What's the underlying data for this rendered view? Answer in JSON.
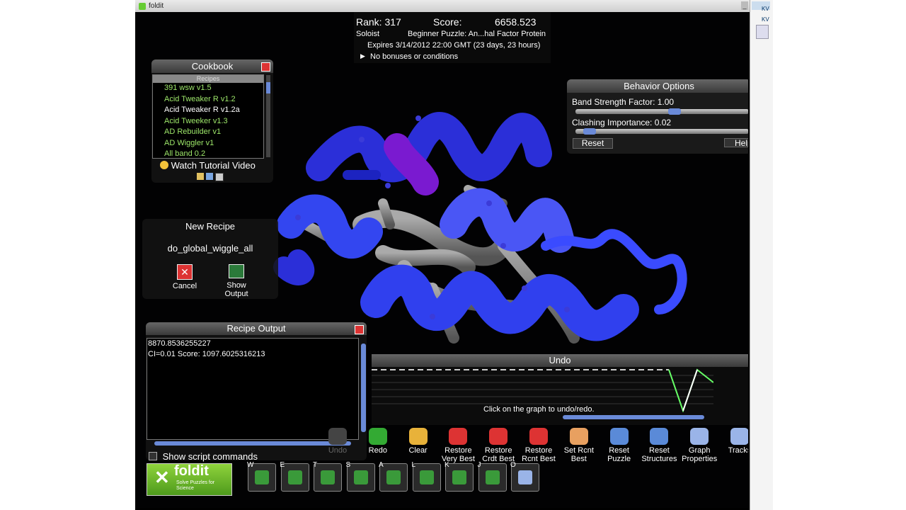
{
  "window": {
    "title": "foldit"
  },
  "status": {
    "rank_label": "Rank: 317",
    "score_label": "Score:",
    "score_value": "6658.523",
    "mode": "Soloist",
    "puzzle": "Beginner Puzzle: An...hal Factor Protein",
    "expires": "Expires 3/14/2012 22:00 GMT (23 days, 23 hours)",
    "bonuses": "No bonuses or conditions"
  },
  "cookbook": {
    "title": "Cookbook",
    "header": "Recipes",
    "items": [
      "391 wsw v1.5",
      "Acid Tweaker  R v1.2",
      "Acid Tweaker  R v1.2a",
      "Acid Tweeker v1.3",
      "AD Rebuilder v1",
      "AD Wiggler v1",
      "All band 0.2"
    ],
    "tutorial": "Watch Tutorial Video"
  },
  "new_recipe": {
    "title": "New Recipe",
    "name": "do_global_wiggle_all",
    "cancel": "Cancel",
    "show_output": "Show Output"
  },
  "recipe_output": {
    "title": "Recipe Output",
    "lines": [
      "8870.8536255227",
      "CI=0.01 Score: 1097.6025316213"
    ],
    "show_commands": "Show script commands"
  },
  "behavior": {
    "title": "Behavior Options",
    "band_label": "Band Strength Factor: 1.00",
    "clash_label": "Clashing Importance: 0.02",
    "band_value": 1.0,
    "clash_value": 0.02,
    "reset": "Reset",
    "help": "Help"
  },
  "undo": {
    "title": "Undo",
    "hint": "Click on the graph to undo/redo."
  },
  "toolbar": [
    {
      "label": "Undo",
      "icon": "undo-icon"
    },
    {
      "label": "Redo",
      "icon": "redo-icon"
    },
    {
      "label": "Clear",
      "icon": "broom-icon"
    },
    {
      "label": "Restore Very Best",
      "icon": "heart-icon"
    },
    {
      "label": "Restore Crdt Best",
      "icon": "heart-icon"
    },
    {
      "label": "Restore Rcnt Best",
      "icon": "heart-icon"
    },
    {
      "label": "Set Rcnt Best",
      "icon": "heart-plus-icon"
    },
    {
      "label": "Reset Puzzle",
      "icon": "reset-icon"
    },
    {
      "label": "Reset Structures",
      "icon": "reset-icon"
    },
    {
      "label": "Graph Properties",
      "icon": "gear-icon"
    },
    {
      "label": "Tracks",
      "icon": "gear-icon"
    }
  ],
  "hotkeys": [
    {
      "key": "W",
      "icon": "shake-icon"
    },
    {
      "key": "E",
      "icon": "sidechain-icon"
    },
    {
      "key": "T",
      "icon": "wiggle-icon"
    },
    {
      "key": "S",
      "icon": "arrow-icon"
    },
    {
      "key": "A",
      "icon": "move-icon"
    },
    {
      "key": "L",
      "icon": "rebuild-icon"
    },
    {
      "key": "K",
      "icon": "loop-icon"
    },
    {
      "key": "J",
      "icon": "structure-icon"
    },
    {
      "key": "O",
      "icon": "gear-icon"
    }
  ],
  "brand": {
    "logo_text": "foldit",
    "tagline": "Solve Puzzles for Science"
  },
  "sidebar": {
    "tab1": "KV",
    "tab2": "KV"
  },
  "colors": {
    "accent_green": "#9ee86a",
    "panel_bg": "#1b1b1b",
    "helix_blue": "#2d3ff0"
  }
}
